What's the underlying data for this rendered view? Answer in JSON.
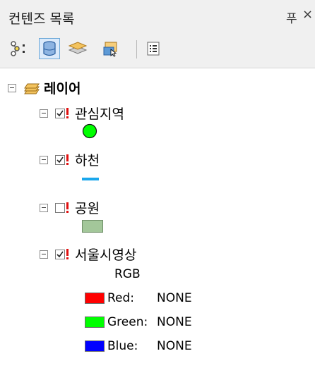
{
  "window": {
    "title": "컨텐즈 목록",
    "pin_glyph": "푸",
    "close_glyph": "×"
  },
  "toolbar": {
    "buttons": [
      {
        "icon": "list-by-drawing-order-icon"
      },
      {
        "icon": "list-by-source-icon"
      },
      {
        "icon": "list-by-visibility-icon"
      },
      {
        "icon": "list-by-selection-icon"
      },
      {
        "icon": "options-icon"
      }
    ]
  },
  "tree": {
    "root_label": "레이어",
    "layers": [
      {
        "name": "관심지역",
        "checked": true,
        "symbol": "circle",
        "symbol_color": "#00ff00"
      },
      {
        "name": "하천",
        "checked": true,
        "symbol": "line",
        "symbol_color": "#1aa7ec"
      },
      {
        "name": "공원",
        "checked": false,
        "symbol": "rect",
        "symbol_color": "#a3c79a"
      },
      {
        "name": "서울시영상",
        "checked": true,
        "symbol": "rgb"
      }
    ],
    "rgb": {
      "heading": "RGB",
      "bands": [
        {
          "label": "Red:",
          "value": "NONE",
          "color": "#ff0000"
        },
        {
          "label": "Green:",
          "value": "NONE",
          "color": "#00ff00"
        },
        {
          "label": "Blue:",
          "value": "NONE",
          "color": "#0000ff"
        }
      ]
    }
  }
}
